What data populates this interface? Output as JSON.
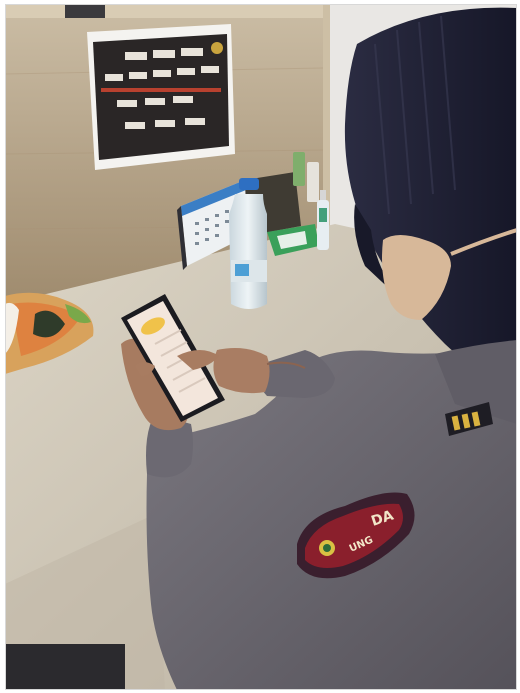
{
  "image": {
    "kind": "photograph",
    "colors": {
      "wall": "#b5a184",
      "desk": "#d7cfbf",
      "uniform": "#6f6c74",
      "hijab": "#23243a",
      "phone_screen": "#f3e6dc"
    }
  },
  "badge": {
    "patch_text": "DA",
    "patch_text_lower": "UNG"
  }
}
